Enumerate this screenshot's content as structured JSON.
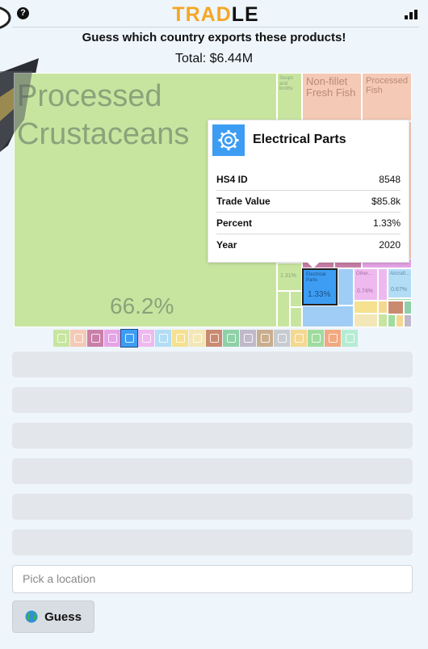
{
  "header": {
    "logo_part1": "TRAD",
    "logo_part2": "LE",
    "help_icon": "help-icon",
    "stats_icon": "bar-chart-icon"
  },
  "question": "Guess which country exports these products!",
  "total": "Total: $6.44M",
  "colors": {
    "accent_orange": "#f5a623",
    "food_green": "#c8e5a0",
    "highlight_blue": "#3d9df3"
  },
  "treemap": {
    "cells": [
      {
        "name": "Processed Crustaceans",
        "pct": "66.2%"
      },
      {
        "name": "Soups and broths",
        "pct": ""
      },
      {
        "name": "Non-fillet Fresh Fish",
        "pct": ""
      },
      {
        "name": "Processed Fish",
        "pct": ""
      },
      {
        "name": "",
        "pct": "1.31%"
      },
      {
        "name": "Electrical Parts",
        "pct": "1.33%"
      },
      {
        "name": "Other...",
        "pct": "0.74%"
      },
      {
        "name": "Aircraft...",
        "pct": "0.67%"
      }
    ]
  },
  "tooltip": {
    "icon": "gear-icon",
    "title": "Electrical Parts",
    "rows": [
      {
        "key": "HS4 ID",
        "value": "8548"
      },
      {
        "key": "Trade Value",
        "value": "$85.8k"
      },
      {
        "key": "Percent",
        "value": "1.33%"
      },
      {
        "key": "Year",
        "value": "2020"
      }
    ]
  },
  "category_icons": [
    {
      "name": "vegetable-icon",
      "color": "#c8e5a0"
    },
    {
      "name": "fish-icon",
      "color": "#f4c9b5"
    },
    {
      "name": "gauge-icon",
      "color": "#c97fa8"
    },
    {
      "name": "flask-icon",
      "color": "#e6a3e6"
    },
    {
      "name": "gear-icon",
      "color": "#3d9df3"
    },
    {
      "name": "plastics-icon",
      "color": "#eeb9ee"
    },
    {
      "name": "shirt-icon",
      "color": "#b3dcf5"
    },
    {
      "name": "paper-icon",
      "color": "#f5e18f"
    },
    {
      "name": "stone-icon",
      "color": "#f3e7b8"
    },
    {
      "name": "pickaxe-icon",
      "color": "#c98a70"
    },
    {
      "name": "clothing-icon",
      "color": "#8fd0a8"
    },
    {
      "name": "shoe-icon",
      "color": "#bfb9c9"
    },
    {
      "name": "sword-icon",
      "color": "#c9ae8e"
    },
    {
      "name": "clock-icon",
      "color": "#c6cbd0"
    },
    {
      "name": "gem-icon",
      "color": "#f5d890"
    },
    {
      "name": "car-icon",
      "color": "#9fdc9f"
    },
    {
      "name": "animal-icon",
      "color": "#f2a880"
    },
    {
      "name": "misc-icon",
      "color": "#b5ecd4"
    }
  ],
  "guess_slots": 6,
  "input": {
    "placeholder": "Pick a location"
  },
  "button": {
    "label": "Guess",
    "icon": "globe-icon"
  }
}
